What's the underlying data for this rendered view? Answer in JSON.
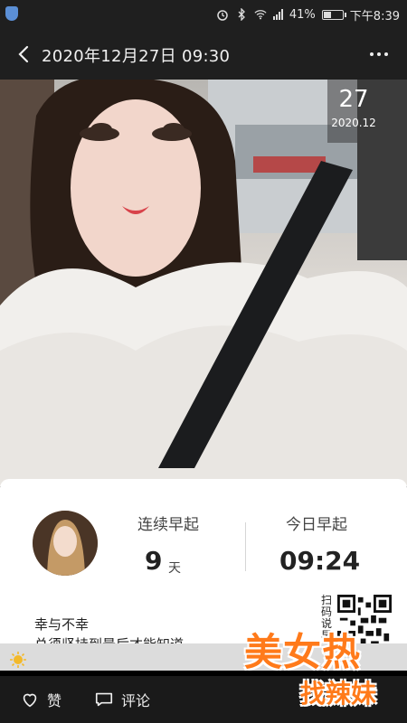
{
  "status_bar": {
    "battery_percent": "41%",
    "battery_level": 0.41,
    "time": "下午8:39",
    "icons": [
      "shield-icon",
      "alarm-icon",
      "bluetooth-icon",
      "wifi-icon",
      "signal-icon",
      "battery-icon"
    ]
  },
  "nav": {
    "title": "2020年12月27日  09:30",
    "back_icon": "chevron-left-icon",
    "more_icon": "more-dots-icon"
  },
  "photo": {
    "date_badge": {
      "day": "27",
      "month": "2020.12"
    }
  },
  "card": {
    "streak": {
      "label": "连续早起",
      "value": "9",
      "unit": "天"
    },
    "today": {
      "label": "今日早起",
      "value": "09:24"
    },
    "quote_line1": "幸与不幸",
    "quote_line2": "总须坚持到最后才能知道",
    "qr_caption": "扫码说早安"
  },
  "watermark": {
    "line1": "美女热",
    "line2": "找辣妹"
  },
  "actions": {
    "like_label": "赞",
    "comment_label": "评论"
  },
  "colors": {
    "accent": "#ff7a1a",
    "bar": "#1a1a1a",
    "card": "#ffffff"
  }
}
